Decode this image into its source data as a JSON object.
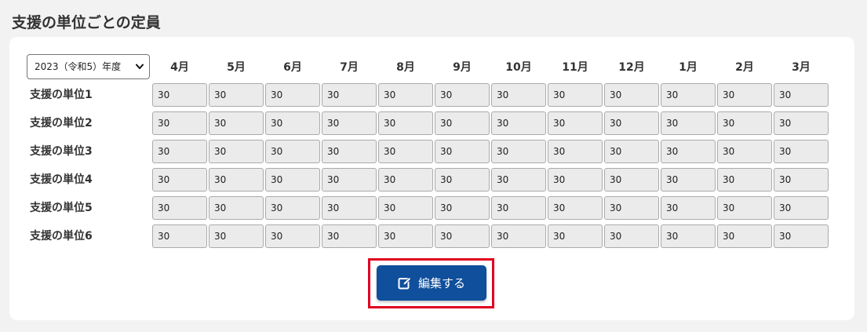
{
  "title": "支援の単位ごとの定員",
  "year_select": {
    "selected": "2023（令和5）年度"
  },
  "months": [
    "4月",
    "5月",
    "6月",
    "7月",
    "8月",
    "9月",
    "10月",
    "11月",
    "12月",
    "1月",
    "2月",
    "3月"
  ],
  "rows": [
    {
      "label": "支援の単位1",
      "values": [
        "30",
        "30",
        "30",
        "30",
        "30",
        "30",
        "30",
        "30",
        "30",
        "30",
        "30",
        "30"
      ]
    },
    {
      "label": "支援の単位2",
      "values": [
        "30",
        "30",
        "30",
        "30",
        "30",
        "30",
        "30",
        "30",
        "30",
        "30",
        "30",
        "30"
      ]
    },
    {
      "label": "支援の単位3",
      "values": [
        "30",
        "30",
        "30",
        "30",
        "30",
        "30",
        "30",
        "30",
        "30",
        "30",
        "30",
        "30"
      ]
    },
    {
      "label": "支援の単位4",
      "values": [
        "30",
        "30",
        "30",
        "30",
        "30",
        "30",
        "30",
        "30",
        "30",
        "30",
        "30",
        "30"
      ]
    },
    {
      "label": "支援の単位5",
      "values": [
        "30",
        "30",
        "30",
        "30",
        "30",
        "30",
        "30",
        "30",
        "30",
        "30",
        "30",
        "30"
      ]
    },
    {
      "label": "支援の単位6",
      "values": [
        "30",
        "30",
        "30",
        "30",
        "30",
        "30",
        "30",
        "30",
        "30",
        "30",
        "30",
        "30"
      ]
    }
  ],
  "edit_button": {
    "label": "編集する",
    "icon": "edit-icon",
    "color": "#0f4f9c"
  },
  "highlight_color": "#e0001e",
  "colors": {
    "input_background": "#ebebeb",
    "panel_background": "#ffffff",
    "page_background": "#f2f2f2"
  }
}
